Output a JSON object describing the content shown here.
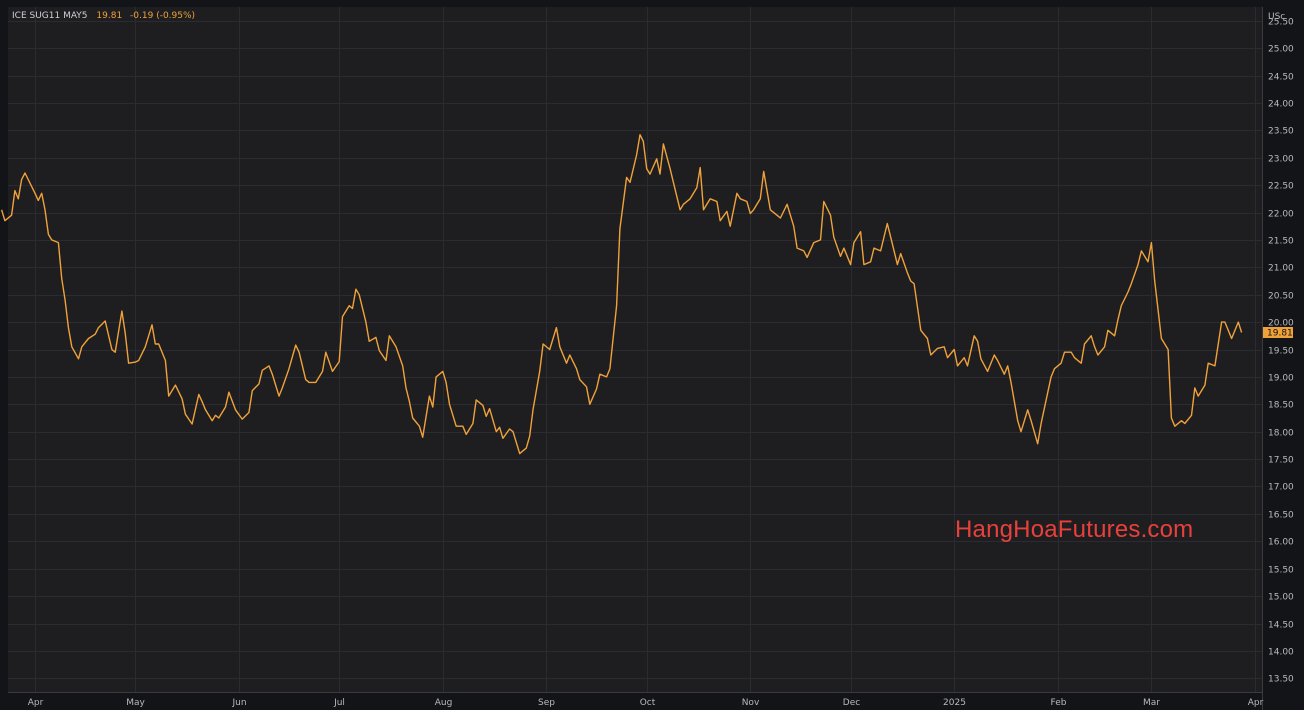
{
  "legend": {
    "symbol": "ICE SUG11 MAY5",
    "last": "19.81",
    "change": "-0.19 (-0.95%)"
  },
  "watermark": "HangHoaFutures.com",
  "colors": {
    "background": "#1e1e21",
    "grid": "#2b2c31",
    "line": "#f0a23a",
    "price_tag": "#f0a23a",
    "axis_text": "#b8b9be",
    "watermark": "#e8403a"
  },
  "chart_data": {
    "type": "line",
    "title": "",
    "currency_label": "USc",
    "ylim": [
      13.25,
      25.75
    ],
    "y_ticks": [
      "13.50",
      "14.00",
      "14.50",
      "15.00",
      "15.50",
      "16.00",
      "16.50",
      "17.00",
      "17.50",
      "18.00",
      "18.50",
      "19.00",
      "19.50",
      "20.00",
      "20.50",
      "21.00",
      "21.50",
      "22.00",
      "22.50",
      "23.00",
      "23.50",
      "24.00",
      "24.50",
      "25.00",
      "25.50"
    ],
    "x_ticks": [
      "Apr",
      "May",
      "Jun",
      "Jul",
      "Aug",
      "Sep",
      "Oct",
      "Nov",
      "Dec",
      "2025",
      "Feb",
      "Mar",
      "Apr"
    ],
    "x_tick_dates": [
      "2024-04-01",
      "2024-05-01",
      "2024-06-01",
      "2024-07-01",
      "2024-08-01",
      "2024-09-01",
      "2024-10-01",
      "2024-11-01",
      "2024-12-01",
      "2025-01-01",
      "2025-02-01",
      "2025-03-01",
      "2025-04-01"
    ],
    "last_value_label": "19.81",
    "grid": true,
    "series": [
      {
        "name": "ICE SUG11 MAY5",
        "points": [
          [
            "2024-03-22",
            22.05
          ],
          [
            "2024-03-23",
            21.85
          ],
          [
            "2024-03-25",
            21.95
          ],
          [
            "2024-03-26",
            22.4
          ],
          [
            "2024-03-27",
            22.25
          ],
          [
            "2024-03-28",
            22.6
          ],
          [
            "2024-03-29",
            22.72
          ],
          [
            "2024-04-01",
            22.35
          ],
          [
            "2024-04-02",
            22.22
          ],
          [
            "2024-04-03",
            22.35
          ],
          [
            "2024-04-04",
            22.05
          ],
          [
            "2024-04-05",
            21.6
          ],
          [
            "2024-04-06",
            21.5
          ],
          [
            "2024-04-08",
            21.45
          ],
          [
            "2024-04-09",
            20.8
          ],
          [
            "2024-04-10",
            20.4
          ],
          [
            "2024-04-11",
            19.9
          ],
          [
            "2024-04-12",
            19.55
          ],
          [
            "2024-04-14",
            19.33
          ],
          [
            "2024-04-15",
            19.55
          ],
          [
            "2024-04-17",
            19.7
          ],
          [
            "2024-04-19",
            19.78
          ],
          [
            "2024-04-20",
            19.9
          ],
          [
            "2024-04-22",
            20.02
          ],
          [
            "2024-04-24",
            19.5
          ],
          [
            "2024-04-25",
            19.45
          ],
          [
            "2024-04-27",
            20.2
          ],
          [
            "2024-04-28",
            19.8
          ],
          [
            "2024-04-29",
            19.25
          ],
          [
            "2024-05-01",
            19.27
          ],
          [
            "2024-05-02",
            19.3
          ],
          [
            "2024-05-04",
            19.55
          ],
          [
            "2024-05-06",
            19.95
          ],
          [
            "2024-05-07",
            19.6
          ],
          [
            "2024-05-08",
            19.6
          ],
          [
            "2024-05-10",
            19.3
          ],
          [
            "2024-05-11",
            18.65
          ],
          [
            "2024-05-13",
            18.85
          ],
          [
            "2024-05-15",
            18.6
          ],
          [
            "2024-05-16",
            18.32
          ],
          [
            "2024-05-18",
            18.14
          ],
          [
            "2024-05-20",
            18.68
          ],
          [
            "2024-05-21",
            18.55
          ],
          [
            "2024-05-22",
            18.4
          ],
          [
            "2024-05-24",
            18.2
          ],
          [
            "2024-05-25",
            18.3
          ],
          [
            "2024-05-26",
            18.25
          ],
          [
            "2024-05-28",
            18.45
          ],
          [
            "2024-05-29",
            18.72
          ],
          [
            "2024-05-31",
            18.4
          ],
          [
            "2024-06-02",
            18.23
          ],
          [
            "2024-06-04",
            18.35
          ],
          [
            "2024-06-05",
            18.75
          ],
          [
            "2024-06-07",
            18.87
          ],
          [
            "2024-06-08",
            19.12
          ],
          [
            "2024-06-10",
            19.2
          ],
          [
            "2024-06-11",
            19.05
          ],
          [
            "2024-06-13",
            18.65
          ],
          [
            "2024-06-14",
            18.8
          ],
          [
            "2024-06-16",
            19.15
          ],
          [
            "2024-06-18",
            19.58
          ],
          [
            "2024-06-19",
            19.45
          ],
          [
            "2024-06-21",
            18.95
          ],
          [
            "2024-06-22",
            18.9
          ],
          [
            "2024-06-24",
            18.9
          ],
          [
            "2024-06-26",
            19.1
          ],
          [
            "2024-06-27",
            19.45
          ],
          [
            "2024-06-29",
            19.1
          ],
          [
            "2024-07-01",
            19.28
          ],
          [
            "2024-07-02",
            20.1
          ],
          [
            "2024-07-04",
            20.3
          ],
          [
            "2024-07-05",
            20.25
          ],
          [
            "2024-07-06",
            20.6
          ],
          [
            "2024-07-07",
            20.5
          ],
          [
            "2024-07-09",
            20.0
          ],
          [
            "2024-07-10",
            19.65
          ],
          [
            "2024-07-12",
            19.72
          ],
          [
            "2024-07-13",
            19.48
          ],
          [
            "2024-07-15",
            19.3
          ],
          [
            "2024-07-16",
            19.75
          ],
          [
            "2024-07-18",
            19.55
          ],
          [
            "2024-07-20",
            19.2
          ],
          [
            "2024-07-21",
            18.8
          ],
          [
            "2024-07-22",
            18.55
          ],
          [
            "2024-07-23",
            18.25
          ],
          [
            "2024-07-25",
            18.1
          ],
          [
            "2024-07-26",
            17.9
          ],
          [
            "2024-07-28",
            18.65
          ],
          [
            "2024-07-29",
            18.45
          ],
          [
            "2024-07-30",
            19.0
          ],
          [
            "2024-08-01",
            19.1
          ],
          [
            "2024-08-02",
            18.9
          ],
          [
            "2024-08-03",
            18.5
          ],
          [
            "2024-08-05",
            18.1
          ],
          [
            "2024-08-07",
            18.1
          ],
          [
            "2024-08-08",
            17.95
          ],
          [
            "2024-08-10",
            18.15
          ],
          [
            "2024-08-11",
            18.58
          ],
          [
            "2024-08-13",
            18.48
          ],
          [
            "2024-08-14",
            18.28
          ],
          [
            "2024-08-15",
            18.42
          ],
          [
            "2024-08-17",
            18.0
          ],
          [
            "2024-08-18",
            18.08
          ],
          [
            "2024-08-19",
            17.88
          ],
          [
            "2024-08-21",
            18.05
          ],
          [
            "2024-08-22",
            18.0
          ],
          [
            "2024-08-24",
            17.6
          ],
          [
            "2024-08-26",
            17.7
          ],
          [
            "2024-08-27",
            17.92
          ],
          [
            "2024-08-28",
            18.4
          ],
          [
            "2024-08-30",
            19.1
          ],
          [
            "2024-08-31",
            19.6
          ],
          [
            "2024-09-02",
            19.5
          ],
          [
            "2024-09-04",
            19.9
          ],
          [
            "2024-09-05",
            19.55
          ],
          [
            "2024-09-07",
            19.25
          ],
          [
            "2024-09-08",
            19.4
          ],
          [
            "2024-09-10",
            19.15
          ],
          [
            "2024-09-11",
            18.95
          ],
          [
            "2024-09-13",
            18.82
          ],
          [
            "2024-09-14",
            18.5
          ],
          [
            "2024-09-16",
            18.78
          ],
          [
            "2024-09-17",
            19.05
          ],
          [
            "2024-09-19",
            19.0
          ],
          [
            "2024-09-20",
            19.15
          ],
          [
            "2024-09-22",
            20.3
          ],
          [
            "2024-09-23",
            21.7
          ],
          [
            "2024-09-25",
            22.64
          ],
          [
            "2024-09-26",
            22.55
          ],
          [
            "2024-09-28",
            23.05
          ],
          [
            "2024-09-29",
            23.42
          ],
          [
            "2024-09-30",
            23.3
          ],
          [
            "2024-10-01",
            22.8
          ],
          [
            "2024-10-02",
            22.7
          ],
          [
            "2024-10-04",
            22.98
          ],
          [
            "2024-10-05",
            22.7
          ],
          [
            "2024-10-06",
            23.25
          ],
          [
            "2024-10-08",
            22.8
          ],
          [
            "2024-10-09",
            22.55
          ],
          [
            "2024-10-11",
            22.05
          ],
          [
            "2024-10-12",
            22.15
          ],
          [
            "2024-10-14",
            22.25
          ],
          [
            "2024-10-16",
            22.45
          ],
          [
            "2024-10-17",
            22.82
          ],
          [
            "2024-10-18",
            22.05
          ],
          [
            "2024-10-20",
            22.25
          ],
          [
            "2024-10-22",
            22.2
          ],
          [
            "2024-10-23",
            21.85
          ],
          [
            "2024-10-25",
            22.02
          ],
          [
            "2024-10-26",
            21.75
          ],
          [
            "2024-10-28",
            22.35
          ],
          [
            "2024-10-29",
            22.25
          ],
          [
            "2024-10-31",
            22.2
          ],
          [
            "2024-11-01",
            21.98
          ],
          [
            "2024-11-02",
            22.05
          ],
          [
            "2024-11-04",
            22.25
          ],
          [
            "2024-11-05",
            22.75
          ],
          [
            "2024-11-06",
            22.4
          ],
          [
            "2024-11-07",
            22.05
          ],
          [
            "2024-11-09",
            21.95
          ],
          [
            "2024-11-10",
            21.9
          ],
          [
            "2024-11-12",
            22.15
          ],
          [
            "2024-11-14",
            21.75
          ],
          [
            "2024-11-15",
            21.35
          ],
          [
            "2024-11-17",
            21.3
          ],
          [
            "2024-11-18",
            21.18
          ],
          [
            "2024-11-20",
            21.45
          ],
          [
            "2024-11-22",
            21.5
          ],
          [
            "2024-11-23",
            22.2
          ],
          [
            "2024-11-25",
            21.95
          ],
          [
            "2024-11-26",
            21.55
          ],
          [
            "2024-11-28",
            21.2
          ],
          [
            "2024-11-29",
            21.35
          ],
          [
            "2024-12-01",
            21.05
          ],
          [
            "2024-12-02",
            21.45
          ],
          [
            "2024-12-04",
            21.65
          ],
          [
            "2024-12-05",
            21.05
          ],
          [
            "2024-12-07",
            21.1
          ],
          [
            "2024-12-08",
            21.35
          ],
          [
            "2024-12-10",
            21.3
          ],
          [
            "2024-12-12",
            21.8
          ],
          [
            "2024-12-13",
            21.55
          ],
          [
            "2024-12-15",
            21.05
          ],
          [
            "2024-12-16",
            21.25
          ],
          [
            "2024-12-18",
            20.9
          ],
          [
            "2024-12-19",
            20.75
          ],
          [
            "2024-12-20",
            20.7
          ],
          [
            "2024-12-22",
            19.85
          ],
          [
            "2024-12-24",
            19.7
          ],
          [
            "2024-12-25",
            19.4
          ],
          [
            "2024-12-27",
            19.52
          ],
          [
            "2024-12-29",
            19.55
          ],
          [
            "2024-12-30",
            19.35
          ],
          [
            "2025-01-01",
            19.5
          ],
          [
            "2025-01-02",
            19.2
          ],
          [
            "2025-01-04",
            19.35
          ],
          [
            "2025-01-05",
            19.2
          ],
          [
            "2025-01-07",
            19.75
          ],
          [
            "2025-01-08",
            19.65
          ],
          [
            "2025-01-09",
            19.33
          ],
          [
            "2025-01-11",
            19.1
          ],
          [
            "2025-01-13",
            19.4
          ],
          [
            "2025-01-14",
            19.3
          ],
          [
            "2025-01-16",
            19.05
          ],
          [
            "2025-01-17",
            19.2
          ],
          [
            "2025-01-18",
            18.9
          ],
          [
            "2025-01-20",
            18.2
          ],
          [
            "2025-01-21",
            18.0
          ],
          [
            "2025-01-23",
            18.4
          ],
          [
            "2025-01-24",
            18.2
          ],
          [
            "2025-01-26",
            17.78
          ],
          [
            "2025-01-27",
            18.15
          ],
          [
            "2025-01-29",
            18.72
          ],
          [
            "2025-01-30",
            19.0
          ],
          [
            "2025-01-31",
            19.15
          ],
          [
            "2025-02-02",
            19.25
          ],
          [
            "2025-02-03",
            19.45
          ],
          [
            "2025-02-05",
            19.45
          ],
          [
            "2025-02-06",
            19.35
          ],
          [
            "2025-02-08",
            19.25
          ],
          [
            "2025-02-09",
            19.6
          ],
          [
            "2025-02-11",
            19.75
          ],
          [
            "2025-02-12",
            19.55
          ],
          [
            "2025-02-13",
            19.4
          ],
          [
            "2025-02-15",
            19.55
          ],
          [
            "2025-02-16",
            19.85
          ],
          [
            "2025-02-18",
            19.75
          ],
          [
            "2025-02-19",
            20.05
          ],
          [
            "2025-02-20",
            20.3
          ],
          [
            "2025-02-22",
            20.55
          ],
          [
            "2025-02-23",
            20.7
          ],
          [
            "2025-02-25",
            21.05
          ],
          [
            "2025-02-26",
            21.3
          ],
          [
            "2025-02-28",
            21.1
          ],
          [
            "2025-03-01",
            21.45
          ],
          [
            "2025-03-02",
            20.75
          ],
          [
            "2025-03-04",
            19.7
          ],
          [
            "2025-03-06",
            19.5
          ],
          [
            "2025-03-07",
            18.25
          ],
          [
            "2025-03-08",
            18.1
          ],
          [
            "2025-03-10",
            18.2
          ],
          [
            "2025-03-11",
            18.15
          ],
          [
            "2025-03-13",
            18.3
          ],
          [
            "2025-03-14",
            18.8
          ],
          [
            "2025-03-15",
            18.65
          ],
          [
            "2025-03-17",
            18.85
          ],
          [
            "2025-03-18",
            19.25
          ],
          [
            "2025-03-20",
            19.2
          ],
          [
            "2025-03-22",
            20.0
          ],
          [
            "2025-03-23",
            20.0
          ],
          [
            "2025-03-25",
            19.7
          ],
          [
            "2025-03-27",
            20.0
          ],
          [
            "2025-03-28",
            19.81
          ]
        ]
      }
    ]
  }
}
